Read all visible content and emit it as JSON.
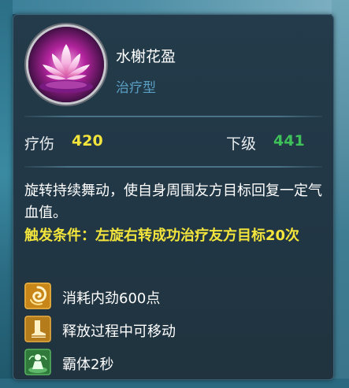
{
  "skill": {
    "name": "水榭花盈",
    "type": "治疗型",
    "icon": "lotus-icon"
  },
  "stats": {
    "damage_label": "疗伤",
    "damage_value": "420",
    "next_label": "下级",
    "next_value": "441"
  },
  "description": "旋转持续舞动，使自身周围友方目标回复一定气血值。",
  "condition": "触发条件：左旋右转成功治疗友方目标20次",
  "properties": [
    {
      "icon": "swirl-icon",
      "text": "消耗内劲600点"
    },
    {
      "icon": "boot-icon",
      "text": "释放过程中可移动"
    },
    {
      "icon": "guard-figure-icon",
      "text": "霸体2秒"
    }
  ],
  "colors": {
    "damage_value": "#f3e53c",
    "next_value": "#3fc15a",
    "type_text": "#5a9fc4",
    "condition_text": "#f3e53c"
  }
}
